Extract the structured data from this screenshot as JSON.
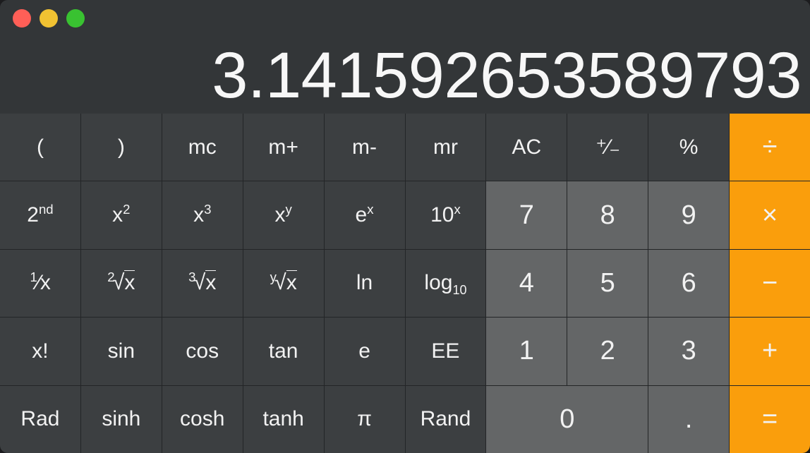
{
  "window": {
    "traffic_lights": [
      {
        "name": "close",
        "color": "#ff5f57"
      },
      {
        "name": "minimize",
        "color": "#f1c232"
      },
      {
        "name": "zoom",
        "color": "#39c231"
      }
    ]
  },
  "display": {
    "value": "3.141592653589793"
  },
  "theme": {
    "window_bg": "#2e3133",
    "titlebar_bg": "#333638",
    "function_key": "#3c3f41",
    "digit_key": "#646667",
    "operator_key": "#fa9e0c",
    "label_color": "#f2f2f2",
    "divider": "#232527"
  },
  "keypad": {
    "rows": [
      [
        {
          "id": "open-paren",
          "label": "(",
          "kind": "fn"
        },
        {
          "id": "close-paren",
          "label": ")",
          "kind": "fn"
        },
        {
          "id": "memory-clear",
          "label": "mc",
          "kind": "fn"
        },
        {
          "id": "memory-add",
          "label": "m+",
          "kind": "fn"
        },
        {
          "id": "memory-sub",
          "label": "m-",
          "kind": "fn"
        },
        {
          "id": "memory-recall",
          "label": "mr",
          "kind": "fn"
        },
        {
          "id": "all-clear",
          "label": "AC",
          "kind": "fn"
        },
        {
          "id": "sign-toggle",
          "label": "+/-",
          "kind": "fn"
        },
        {
          "id": "percent",
          "label": "%",
          "kind": "fn"
        },
        {
          "id": "divide",
          "label": "÷",
          "kind": "op"
        }
      ],
      [
        {
          "id": "second",
          "label": "2nd",
          "kind": "fn"
        },
        {
          "id": "x-squared",
          "label": "x2",
          "kind": "fn"
        },
        {
          "id": "x-cubed",
          "label": "x3",
          "kind": "fn"
        },
        {
          "id": "x-to-y",
          "label": "xy",
          "kind": "fn"
        },
        {
          "id": "e-to-x",
          "label": "ex",
          "kind": "fn"
        },
        {
          "id": "ten-to-x",
          "label": "10x",
          "kind": "fn"
        },
        {
          "id": "seven",
          "label": "7",
          "kind": "digit"
        },
        {
          "id": "eight",
          "label": "8",
          "kind": "digit"
        },
        {
          "id": "nine",
          "label": "9",
          "kind": "digit"
        },
        {
          "id": "multiply",
          "label": "×",
          "kind": "op"
        }
      ],
      [
        {
          "id": "reciprocal",
          "label": "1/x",
          "kind": "fn"
        },
        {
          "id": "square-root",
          "label": "2√x",
          "kind": "fn"
        },
        {
          "id": "cube-root",
          "label": "3√x",
          "kind": "fn"
        },
        {
          "id": "y-root",
          "label": "y√x",
          "kind": "fn"
        },
        {
          "id": "natural-log",
          "label": "ln",
          "kind": "fn"
        },
        {
          "id": "log-base-10",
          "label": "log10",
          "kind": "fn"
        },
        {
          "id": "four",
          "label": "4",
          "kind": "digit"
        },
        {
          "id": "five",
          "label": "5",
          "kind": "digit"
        },
        {
          "id": "six",
          "label": "6",
          "kind": "digit"
        },
        {
          "id": "subtract",
          "label": "−",
          "kind": "op"
        }
      ],
      [
        {
          "id": "factorial",
          "label": "x!",
          "kind": "fn"
        },
        {
          "id": "sin",
          "label": "sin",
          "kind": "fn"
        },
        {
          "id": "cos",
          "label": "cos",
          "kind": "fn"
        },
        {
          "id": "tan",
          "label": "tan",
          "kind": "fn"
        },
        {
          "id": "euler",
          "label": "e",
          "kind": "fn"
        },
        {
          "id": "ee",
          "label": "EE",
          "kind": "fn"
        },
        {
          "id": "one",
          "label": "1",
          "kind": "digit"
        },
        {
          "id": "two",
          "label": "2",
          "kind": "digit"
        },
        {
          "id": "three",
          "label": "3",
          "kind": "digit"
        },
        {
          "id": "add",
          "label": "+",
          "kind": "op"
        }
      ],
      [
        {
          "id": "rad",
          "label": "Rad",
          "kind": "fn"
        },
        {
          "id": "sinh",
          "label": "sinh",
          "kind": "fn"
        },
        {
          "id": "cosh",
          "label": "cosh",
          "kind": "fn"
        },
        {
          "id": "tanh",
          "label": "tanh",
          "kind": "fn"
        },
        {
          "id": "pi",
          "label": "π",
          "kind": "fn"
        },
        {
          "id": "rand",
          "label": "Rand",
          "kind": "fn"
        },
        {
          "id": "zero",
          "label": "0",
          "kind": "digit",
          "span": 2
        },
        {
          "id": "decimal",
          "label": ".",
          "kind": "digit"
        },
        {
          "id": "equals",
          "label": "=",
          "kind": "op"
        }
      ]
    ]
  }
}
